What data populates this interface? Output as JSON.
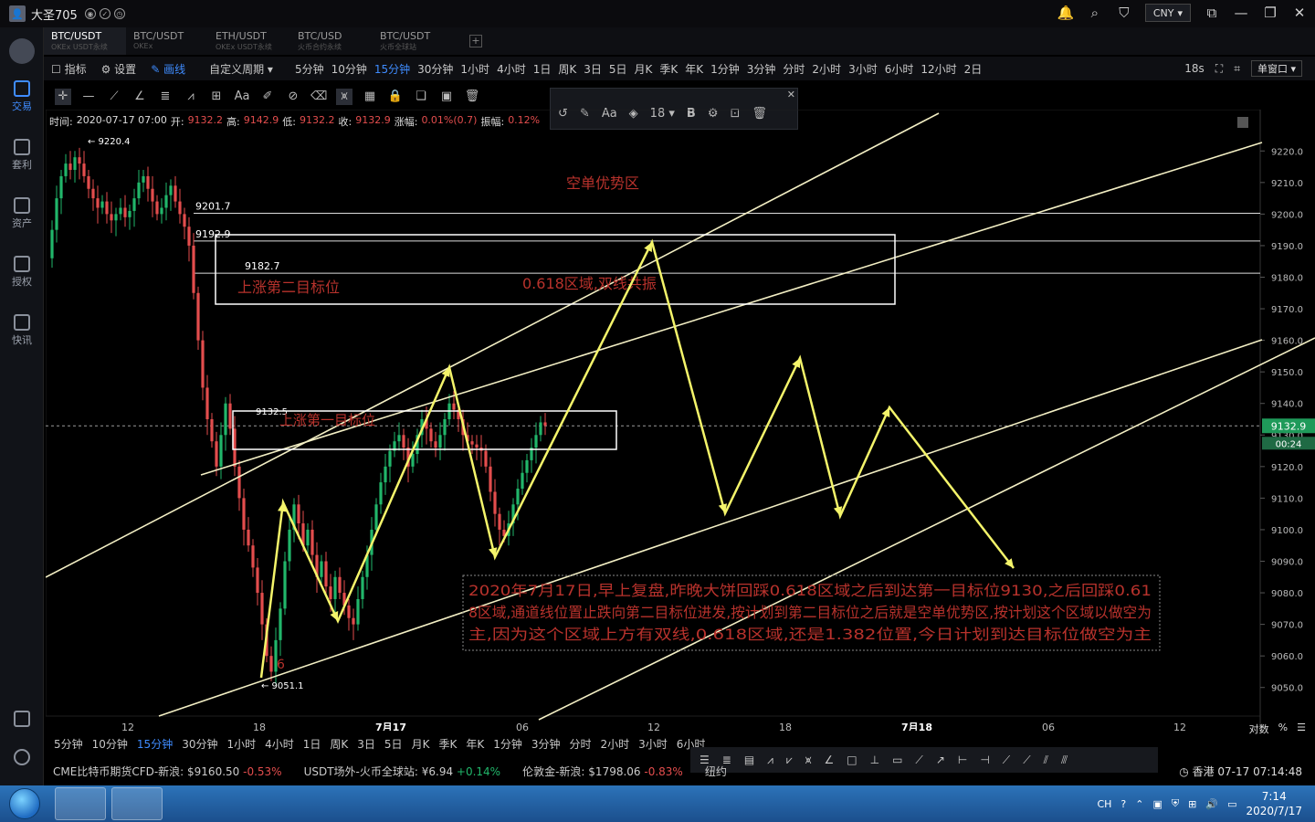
{
  "titlebar": {
    "user": "大圣705",
    "currency": "CNY",
    "avatar_glyph": "👤"
  },
  "sidebar": {
    "items": [
      {
        "label": "交易",
        "active": true
      },
      {
        "label": "套利",
        "active": false
      },
      {
        "label": "资产",
        "active": false
      },
      {
        "label": "授权",
        "active": false
      },
      {
        "label": "快讯",
        "active": false
      }
    ]
  },
  "symbol_tabs": [
    {
      "symbol": "BTC/USDT",
      "exchange": "OKEx USDT永续",
      "active": true
    },
    {
      "symbol": "BTC/USDT",
      "exchange": "OKEx",
      "active": false
    },
    {
      "symbol": "ETH/USDT",
      "exchange": "OKEx USDT永续",
      "active": false
    },
    {
      "symbol": "BTC/USD",
      "exchange": "火币合约永续",
      "active": false
    },
    {
      "symbol": "BTC/USDT",
      "exchange": "火币全球站",
      "active": false
    }
  ],
  "period_bar": {
    "indicator": "指标",
    "settings": "设置",
    "draw": "画线",
    "custom_period": "自定义周期",
    "periods": [
      "5分钟",
      "10分钟",
      "15分钟",
      "30分钟",
      "1小时",
      "4小时",
      "1日",
      "周K",
      "3日",
      "5日",
      "月K",
      "季K",
      "年K",
      "1分钟",
      "3分钟",
      "分时",
      "2小时",
      "3小时",
      "6小时",
      "12小时",
      "2日"
    ],
    "active_period": "15分钟",
    "refresh": "18s",
    "window_mode": "单窗口"
  },
  "float_toolbar": {
    "font_size": "18",
    "bold": "B",
    "text_tool": "Aa"
  },
  "info_line": {
    "time_label": "时间:",
    "time": "2020-07-17 07:00",
    "open_label": "开:",
    "open": "9132.2",
    "high_label": "高:",
    "high": "9142.9",
    "low_label": "低:",
    "low": "9132.2",
    "close_label": "收:",
    "close": "9132.9",
    "change_label": "涨幅:",
    "change": "0.01%(0.7)",
    "amp_label": "振幅:",
    "amp": "0.12%"
  },
  "chart_data": {
    "type": "candlestick",
    "y_ticks": [
      9220.0,
      9210.0,
      9200.0,
      9190.0,
      9180.0,
      9170.0,
      9160.0,
      9150.0,
      9140.0,
      9130.0,
      9120.0,
      9110.0,
      9100.0,
      9090.0,
      9080.0,
      9070.0,
      9060.0,
      9050.0
    ],
    "ylim": [
      9045,
      9225
    ],
    "x_ticks": [
      "12",
      "18",
      "7月17",
      "06",
      "12",
      "18",
      "7月18",
      "06",
      "12"
    ],
    "current_price": "9132.9",
    "countdown": "00:24",
    "price_labels": [
      "9220.4",
      "9201.7",
      "9192.9",
      "9182.7",
      "9132.5",
      "9051.1"
    ],
    "horizontal_levels": [
      9201.7,
      9192.9,
      9182.7
    ],
    "annotations": {
      "short_zone": "空单优势区",
      "target2": "上涨第二目标位",
      "zone_618": "0.618区域,双线共振",
      "target1": "上涨第一目标位",
      "marker": "6",
      "note": "2020年7月17日,早上复盘,昨晚大饼回踩0.618区域之后到达第一目标位9130,之后回踩0.618区域,通道线位置止跌向第二目标位进发,按计划到第二目标位之后就是空单优势区,按计划这个区域以做空为主,因为这个区域上方有双线,0.618区域,还是1.382位置,今日计划到达目标位做空为主"
    },
    "forecast_path": [
      [
        9051,
        9108
      ],
      [
        9071,
        9151
      ],
      [
        9090,
        9189
      ],
      [
        9105,
        9154
      ],
      [
        9106,
        9138
      ],
      [
        9084
      ]
    ]
  },
  "bottom_right": {
    "log": "对数",
    "percent": "%"
  },
  "ticker": [
    {
      "name": "CME比特币期货CFD-新浪:",
      "price": "$9160.50",
      "change": "-0.53%",
      "dir": "neg"
    },
    {
      "name": "USDT场外-火币全球站:",
      "price": "¥6.94",
      "change": "+0.14%",
      "dir": "pos"
    },
    {
      "name": "伦敦金-新浪:",
      "price": "$1798.06",
      "change": "-0.83%",
      "dir": "neg"
    },
    {
      "name": "纽约",
      "price": "",
      "change": "",
      "dir": "neg"
    }
  ],
  "ticker_time": "香港 07-17 07:14:48",
  "taskbar": {
    "lang": "CH",
    "time": "7:14",
    "date": "2020/7/17"
  },
  "colors": {
    "up": "#21b66a",
    "down": "#e34d4d",
    "accent": "#3f8cff",
    "forecast": "#f4f46a",
    "channel": "#f3efc4"
  }
}
